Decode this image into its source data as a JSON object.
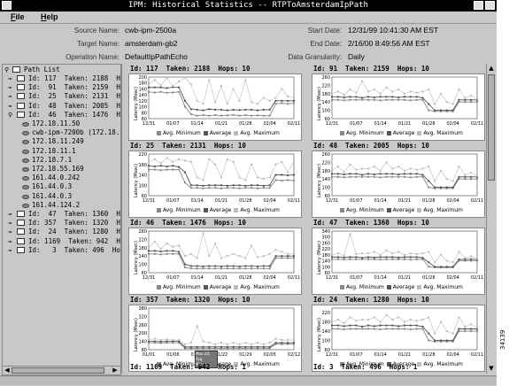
{
  "window": {
    "title": "IPM: Historical Statistics -- RTPToAmsterdamIpPath"
  },
  "menu": [
    {
      "label": "File",
      "mnemonic": "F",
      "rest": "ile"
    },
    {
      "label": "Help",
      "mnemonic": "H",
      "rest": "elp"
    }
  ],
  "info": {
    "source_name_label": "Source Name:",
    "source_name": "cwb-ipm-2500a",
    "target_name_label": "Target Name:",
    "target_name": "amsterdam-gb2",
    "operation_name_label": "Operation Name:",
    "operation_name": "DefaultIpPathEcho",
    "start_date_label": "Start Date:",
    "start_date": "12/31/99 10:41:30 AM EST",
    "end_date_label": "End Date:",
    "end_date": "2/16/00 8:49:56 AM EST",
    "granularity_label": "Data Granularity:",
    "granularity": "Daily"
  },
  "tree": {
    "root": "Path List",
    "items": [
      {
        "text": "Id: 117  Taken: 2188  Hops: 10",
        "kind": "path",
        "expanded": false
      },
      {
        "text": "Id:  91  Taken: 2159  Hops: 10",
        "kind": "path",
        "expanded": false
      },
      {
        "text": "Id:  25  Taken: 2131  Hops: 10",
        "kind": "path",
        "expanded": false
      },
      {
        "text": "Id:  48  Taken: 2005  Hops: 10",
        "kind": "path",
        "expanded": false
      },
      {
        "text": "Id:  46  Taken: 1476  Hops: 10",
        "kind": "path",
        "expanded": true
      },
      {
        "text": "172.18.11.50",
        "kind": "hop"
      },
      {
        "text": "cwb-ipm-7200b (172.18.1",
        "kind": "hop"
      },
      {
        "text": "172.18.11.249",
        "kind": "hop"
      },
      {
        "text": "172.18.11.1",
        "kind": "hop"
      },
      {
        "text": "172.18.7.1",
        "kind": "hop"
      },
      {
        "text": "172.18.55.169",
        "kind": "hop"
      },
      {
        "text": "161.44.0.242",
        "kind": "hop"
      },
      {
        "text": "161.44.0.3",
        "kind": "hop"
      },
      {
        "text": "161.44.0.3",
        "kind": "hop"
      },
      {
        "text": "161.44.124.2",
        "kind": "hop"
      },
      {
        "text": "Id:  47  Taken: 1360  Hops: 10",
        "kind": "path",
        "expanded": false
      },
      {
        "text": "Id: 357  Taken: 1320  Hops: 10",
        "kind": "path",
        "expanded": false
      },
      {
        "text": "Id:  24  Taken: 1280  Hops: 10",
        "kind": "path",
        "expanded": false
      },
      {
        "text": "Id: 1169  Taken: 942  Hops: 1",
        "kind": "path",
        "expanded": false
      },
      {
        "text": "Id:   3  Taken: 496  Hops: 1",
        "kind": "path",
        "expanded": false
      }
    ]
  },
  "legend": {
    "min": "Avg. Minimum",
    "avg": "Average",
    "max": "Avg. Maximum"
  },
  "colors": {
    "min": "#888888",
    "avg": "#555555",
    "max": "#bbbbbb"
  },
  "ylabel": "Latency (Msec)",
  "side_number": "34139",
  "tooltip_lines": [
    "Max 2/1",
    "Avg",
    "Min"
  ],
  "chart_data": [
    {
      "type": "line",
      "title": "Id: 117  Taken: 2188  Hops: 10",
      "ylabel": "Latency (Msec)",
      "ylim": [
        60,
        200
      ],
      "yticks": [
        60,
        80,
        100,
        120,
        140,
        160,
        180,
        200
      ],
      "categories": [
        "12/31",
        "01/07",
        "01/14",
        "01/21",
        "01/28",
        "02/04",
        "02/11"
      ],
      "series": [
        {
          "name": "Avg. Minimum",
          "values": [
            150,
            148,
            150,
            147,
            148,
            150,
            100,
            75,
            70,
            72,
            70,
            72,
            70,
            71,
            72,
            70,
            72,
            70,
            71,
            70,
            70,
            110,
            112,
            110,
            112
          ]
        },
        {
          "name": "Average",
          "values": [
            165,
            165,
            165,
            163,
            166,
            165,
            120,
            92,
            90,
            88,
            92,
            90,
            90,
            88,
            90,
            89,
            90,
            90,
            88,
            90,
            90,
            120,
            120,
            120,
            120
          ]
        },
        {
          "name": "Avg. Maximum",
          "values": [
            175,
            190,
            172,
            195,
            170,
            185,
            198,
            175,
            120,
            110,
            190,
            115,
            170,
            110,
            160,
            120,
            190,
            115,
            110,
            130,
            120,
            130,
            160,
            135,
            130
          ]
        }
      ]
    },
    {
      "type": "line",
      "title": "Id: 91  Taken: 2159  Hops: 10",
      "ylabel": "Latency (Msec)",
      "ylim": [
        60,
        260
      ],
      "yticks": [
        60,
        80,
        100,
        120,
        140,
        160,
        180,
        200,
        220,
        240,
        260
      ],
      "categories": [
        "12/31",
        "01/07",
        "01/14",
        "01/21",
        "01/28",
        "02/04",
        "02/11"
      ],
      "series": [
        {
          "name": "Avg. Minimum",
          "values": [
            150,
            150,
            148,
            150,
            150,
            150,
            150,
            150,
            148,
            150,
            150,
            150,
            150,
            148,
            150,
            150,
            100,
            95,
            95,
            95,
            95,
            140,
            140,
            140,
            140
          ]
        },
        {
          "name": "Average",
          "values": [
            165,
            165,
            162,
            165,
            165,
            160,
            165,
            162,
            165,
            165,
            165,
            162,
            165,
            165,
            165,
            160,
            130,
            100,
            100,
            100,
            100,
            150,
            150,
            150,
            150
          ]
        },
        {
          "name": "Avg. Maximum",
          "values": [
            180,
            190,
            175,
            200,
            185,
            240,
            190,
            200,
            180,
            210,
            190,
            200,
            180,
            190,
            185,
            190,
            200,
            130,
            180,
            140,
            130,
            200,
            160,
            170,
            155
          ]
        }
      ]
    },
    {
      "type": "line",
      "title": "Id: 25  Taken: 2131  Hops: 10",
      "ylabel": "Latency (Msec)",
      "ylim": [
        60,
        220
      ],
      "yticks": [
        60,
        80,
        100,
        120,
        140,
        160,
        180,
        200,
        220
      ],
      "categories": [
        "12/31",
        "01/07",
        "01/14",
        "01/21",
        "01/28",
        "02/04",
        "02/11"
      ],
      "series": [
        {
          "name": "Avg. Minimum",
          "values": [
            160,
            160,
            158,
            160,
            160,
            160,
            110,
            90,
            90,
            88,
            90,
            90,
            88,
            90,
            90,
            88,
            90,
            90,
            88,
            90,
            90,
            120,
            118,
            120,
            118
          ]
        },
        {
          "name": "Average",
          "values": [
            175,
            172,
            175,
            172,
            175,
            170,
            150,
            100,
            100,
            98,
            100,
            100,
            100,
            98,
            100,
            100,
            98,
            100,
            100,
            98,
            100,
            140,
            140,
            138,
            140
          ]
        },
        {
          "name": "Avg. Maximum",
          "values": [
            190,
            200,
            185,
            205,
            190,
            200,
            195,
            190,
            130,
            120,
            200,
            180,
            130,
            200,
            190,
            130,
            120,
            180,
            130,
            125,
            130,
            180,
            190,
            150,
            190
          ]
        }
      ]
    },
    {
      "type": "line",
      "title": "Id: 48  Taken: 2005  Hops: 10",
      "ylabel": "Latency (Msec)",
      "ylim": [
        60,
        260
      ],
      "yticks": [
        60,
        80,
        100,
        120,
        140,
        160,
        180,
        200,
        220,
        240,
        260
      ],
      "categories": [
        "12/31",
        "01/07",
        "01/14",
        "01/21",
        "01/28",
        "02/04",
        "02/11"
      ],
      "series": [
        {
          "name": "Avg. Minimum",
          "values": [
            150,
            150,
            148,
            150,
            150,
            150,
            150,
            150,
            148,
            150,
            150,
            150,
            150,
            148,
            150,
            150,
            100,
            95,
            95,
            95,
            95,
            140,
            140,
            140,
            140
          ]
        },
        {
          "name": "Average",
          "values": [
            165,
            165,
            162,
            165,
            165,
            160,
            165,
            162,
            165,
            165,
            165,
            162,
            165,
            165,
            165,
            160,
            130,
            100,
            100,
            100,
            100,
            150,
            150,
            150,
            150
          ]
        },
        {
          "name": "Avg. Maximum",
          "values": [
            180,
            200,
            175,
            210,
            185,
            190,
            190,
            200,
            180,
            220,
            190,
            200,
            180,
            190,
            185,
            190,
            200,
            130,
            180,
            140,
            130,
            200,
            160,
            170,
            155
          ]
        }
      ]
    },
    {
      "type": "line",
      "title": "Id: 46  Taken: 1476  Hops: 10",
      "ylabel": "Latency (Msec)",
      "ylim": [
        60,
        260
      ],
      "yticks": [
        60,
        80,
        100,
        120,
        140,
        160,
        180,
        200,
        220,
        240,
        260
      ],
      "categories": [
        "12/31",
        "01/07",
        "01/14",
        "01/21",
        "01/28",
        "02/04",
        "02/11"
      ],
      "series": [
        {
          "name": "Avg. Minimum",
          "values": [
            150,
            150,
            148,
            150,
            150,
            150,
            85,
            80,
            80,
            80,
            80,
            80,
            80,
            80,
            80,
            80,
            80,
            80,
            80,
            80,
            80,
            130,
            130,
            130,
            130
          ]
        },
        {
          "name": "Average",
          "values": [
            165,
            165,
            162,
            165,
            165,
            160,
            100,
            92,
            92,
            90,
            92,
            92,
            90,
            92,
            92,
            90,
            92,
            92,
            90,
            92,
            92,
            140,
            140,
            140,
            140
          ]
        },
        {
          "name": "Avg. Maximum",
          "values": [
            180,
            210,
            175,
            200,
            185,
            190,
            140,
            150,
            130,
            250,
            140,
            200,
            130,
            140,
            150,
            140,
            130,
            190,
            135,
            140,
            150,
            170,
            160,
            150,
            150
          ]
        }
      ]
    },
    {
      "type": "line",
      "title": "Id: 47  Taken: 1360  Hops: 10",
      "ylabel": "Latency (Msec)",
      "ylim": [
        60,
        340
      ],
      "yticks": [
        60,
        100,
        140,
        180,
        220,
        260,
        300,
        340
      ],
      "categories": [
        "12/31",
        "01/07",
        "01/14",
        "01/21",
        "01/28",
        "02/04",
        "02/11"
      ],
      "series": [
        {
          "name": "Avg. Minimum",
          "values": [
            150,
            150,
            148,
            150,
            150,
            150,
            150,
            150,
            148,
            150,
            150,
            150,
            150,
            148,
            150,
            150,
            100,
            95,
            95,
            95,
            95,
            140,
            140,
            140,
            140
          ]
        },
        {
          "name": "Average",
          "values": [
            165,
            165,
            162,
            165,
            165,
            160,
            165,
            162,
            165,
            165,
            165,
            162,
            165,
            165,
            165,
            160,
            130,
            100,
            100,
            100,
            100,
            150,
            150,
            150,
            150
          ]
        },
        {
          "name": "Avg. Maximum",
          "values": [
            180,
            190,
            175,
            320,
            185,
            190,
            190,
            200,
            180,
            210,
            190,
            200,
            180,
            190,
            185,
            190,
            200,
            130,
            180,
            140,
            130,
            200,
            160,
            170,
            155
          ]
        }
      ]
    },
    {
      "type": "line",
      "title": "Id: 357  Taken: 1320  Hops: 10",
      "ylabel": "Latency (Msec)",
      "ylim": [
        80,
        380
      ],
      "yticks": [
        80,
        110,
        140,
        170,
        200,
        230,
        260,
        290,
        320,
        350,
        380
      ],
      "categories": [
        "01/01",
        "01/08",
        "01/15",
        "01/22",
        "01/29",
        "02/05",
        "02/12"
      ],
      "series": [
        {
          "name": "Avg. Minimum",
          "values": [
            130,
            130,
            128,
            130,
            130,
            130,
            90,
            90,
            90,
            90,
            90,
            90,
            90,
            90,
            90,
            90,
            90,
            90,
            90,
            90,
            90,
            120,
            120,
            120,
            120
          ]
        },
        {
          "name": "Average",
          "values": [
            140,
            140,
            138,
            140,
            140,
            140,
            100,
            100,
            100,
            100,
            100,
            100,
            100,
            100,
            100,
            100,
            100,
            100,
            100,
            100,
            100,
            130,
            130,
            130,
            130
          ]
        },
        {
          "name": "Avg. Maximum",
          "values": [
            150,
            160,
            150,
            155,
            150,
            150,
            120,
            130,
            250,
            140,
            130,
            120,
            130,
            120,
            130,
            120,
            130,
            120,
            130,
            120,
            130,
            160,
            150,
            150,
            150
          ]
        }
      ]
    },
    {
      "type": "line",
      "title": "Id: 24  Taken: 1280  Hops: 10",
      "ylabel": "Latency (Msec)",
      "ylim": [
        60,
        240
      ],
      "yticks": [
        60,
        80,
        100,
        120,
        140,
        160,
        180,
        200,
        220,
        240
      ],
      "categories": [
        "12/31",
        "01/07",
        "01/14",
        "01/21",
        "01/28",
        "02/04",
        "02/11"
      ],
      "series": [
        {
          "name": "Avg. Minimum",
          "values": [
            150,
            150,
            148,
            150,
            150,
            150,
            150,
            150,
            148,
            150,
            150,
            150,
            150,
            148,
            150,
            150,
            100,
            95,
            95,
            95,
            95,
            140,
            140,
            140,
            140
          ]
        },
        {
          "name": "Average",
          "values": [
            165,
            165,
            162,
            165,
            165,
            160,
            165,
            162,
            165,
            165,
            165,
            162,
            165,
            165,
            165,
            160,
            130,
            100,
            100,
            100,
            100,
            150,
            150,
            150,
            150
          ]
        },
        {
          "name": "Avg. Maximum",
          "values": [
            180,
            190,
            175,
            200,
            185,
            190,
            190,
            200,
            180,
            210,
            190,
            200,
            180,
            190,
            185,
            190,
            200,
            130,
            180,
            140,
            130,
            200,
            160,
            170,
            155
          ]
        }
      ]
    }
  ],
  "next_charts": [
    {
      "title": "Id: 1169  Taken: 942  Hops: 1"
    },
    {
      "title": "Id: 3  Taken: 496  Hops: 1"
    }
  ]
}
